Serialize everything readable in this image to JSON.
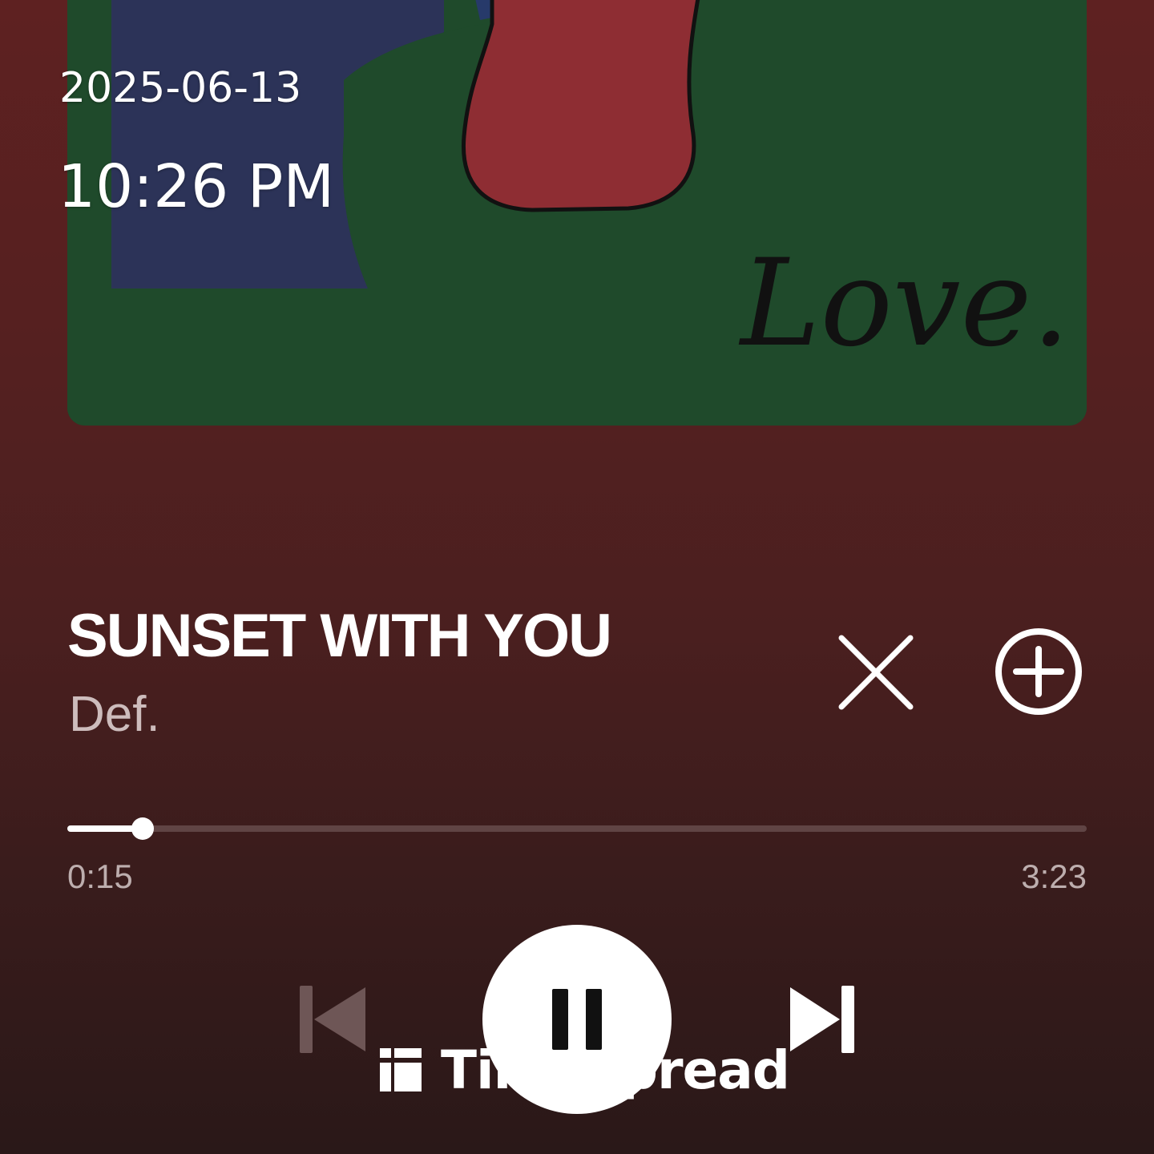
{
  "overlay": {
    "date": "2025-06-13",
    "time": "10:26 PM"
  },
  "album_art": {
    "caption": "Love."
  },
  "track": {
    "title": "SUNSET WITH YOU",
    "artist": "Def."
  },
  "playback": {
    "elapsed": "0:15",
    "duration": "3:23",
    "progress_fraction": 0.074,
    "state": "playing"
  },
  "controls": {
    "previous_icon": "skip-previous-icon",
    "play_pause_icon": "pause-icon",
    "next_icon": "skip-next-icon",
    "close_icon": "close-icon",
    "add_icon": "plus-circle-icon"
  },
  "watermark": {
    "text": "TimeSpread"
  },
  "colors": {
    "background_top": "#5e2121",
    "background_bottom": "#2a1818",
    "artist_text": "#cdbcbc",
    "time_text": "#bdaeae",
    "accent": "#ffffff"
  }
}
